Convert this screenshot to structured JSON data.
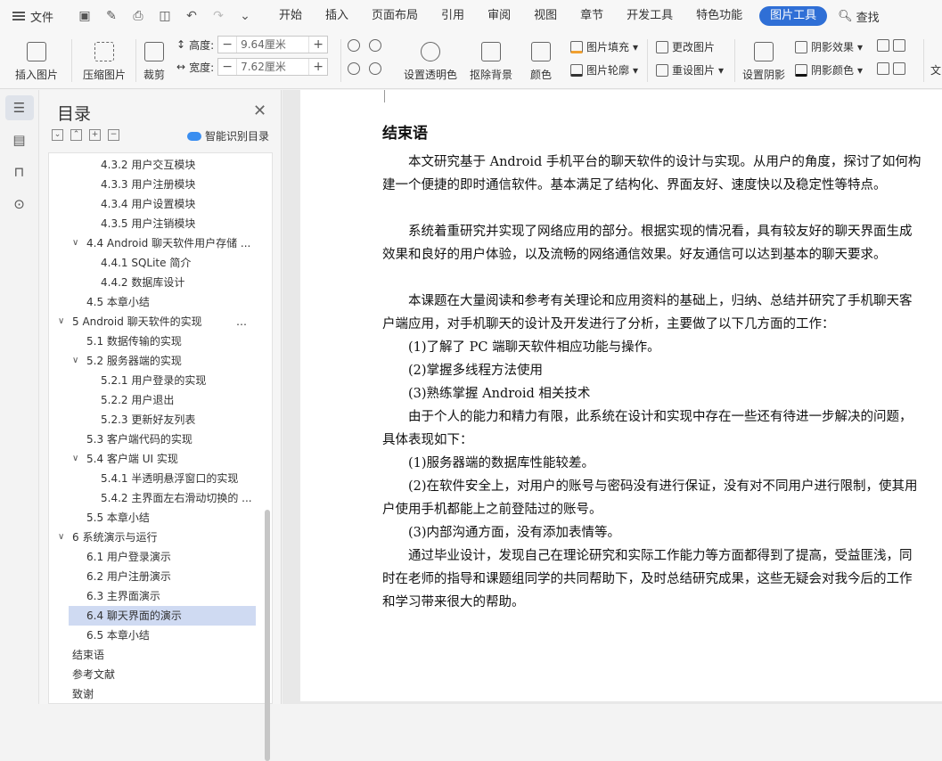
{
  "menubar": {
    "file_label": "文件",
    "tabs": [
      "开始",
      "插入",
      "页面布局",
      "引用",
      "审阅",
      "视图",
      "章节",
      "开发工具",
      "特色功能",
      "图片工具"
    ],
    "search_label": "查找"
  },
  "ribbon": {
    "insert_picture": "插入图片",
    "compress_picture": "压缩图片",
    "crop": "裁剪",
    "height_label": "高度:",
    "height_value": "9.64厘米",
    "width_label": "宽度:",
    "width_value": "7.62厘米",
    "set_transparent": "设置透明色",
    "remove_bg": "抠除背景",
    "color": "颜色",
    "picture_fill": "图片填充",
    "picture_outline": "图片轮廓",
    "change_picture": "更改图片",
    "reset_picture": "重设图片",
    "set_shadow": "设置阴影",
    "shadow_effect": "阴影效果",
    "shadow_color": "阴影颜色",
    "text_cut": "文"
  },
  "toc": {
    "title": "目录",
    "smart_label": "智能识别目录",
    "items": [
      {
        "label": "4.3.2 用户交互模块"
      },
      {
        "label": "4.3.3 用户注册模块"
      },
      {
        "label": "4.3.4 用户设置模块"
      },
      {
        "label": "4.3.5 用户注销模块"
      },
      {
        "label": "4.4 Android 聊天软件用户存储 ..."
      },
      {
        "label": "4.4.1 SQLite 简介"
      },
      {
        "label": "4.4.2 数据库设计"
      },
      {
        "label": "4.5 本章小结"
      },
      {
        "label": "5 Android 聊天软件的实现"
      },
      {
        "label": "5.1 数据传输的实现"
      },
      {
        "label": "5.2 服务器端的实现"
      },
      {
        "label": "5.2.1 用户登录的实现"
      },
      {
        "label": "5.2.2 用户退出"
      },
      {
        "label": "5.2.3 更新好友列表"
      },
      {
        "label": "5.3 客户端代码的实现"
      },
      {
        "label": "5.4 客户端 UI 实现"
      },
      {
        "label": "5.4.1 半透明悬浮窗口的实现"
      },
      {
        "label": "5.4.2 主界面左右滑动切换的 ..."
      },
      {
        "label": "5.5 本章小结"
      },
      {
        "label": "6 系统演示与运行"
      },
      {
        "label": "6.1 用户登录演示"
      },
      {
        "label": "6.2 用户注册演示"
      },
      {
        "label": "6.3 主界面演示"
      },
      {
        "label": "6.4 聊天界面的演示"
      },
      {
        "label": "6.5 本章小结"
      },
      {
        "label": "结束语"
      },
      {
        "label": "参考文献"
      },
      {
        "label": "致谢"
      }
    ]
  },
  "document": {
    "heading": "结束语",
    "paragraphs": [
      "本文研究基于 Android 手机平台的聊天软件的设计与实现。从用户的角度，探讨了如何构建一个便捷的即时通信软件。基本满足了结构化、界面友好、速度快以及稳定性等特点。",
      "系统着重研究并实现了网络应用的部分。根据实现的情况看，具有较友好的聊天界面生成效果和良好的用户体验，以及流畅的网络通信效果。好友通信可以达到基本的聊天要求。",
      "本课题在大量阅读和参考有关理论和应用资料的基础上，归纳、总结并研究了手机聊天客户端应用，对手机聊天的设计及开发进行了分析，主要做了以下几方面的工作：",
      "(1)了解了 PC 端聊天软件相应功能与操作。",
      "(2)掌握多线程方法使用",
      "(3)熟练掌握 Android 相关技术",
      "由于个人的能力和精力有限，此系统在设计和实现中存在一些还有待进一步解决的问题，具体表现如下：",
      "(1)服务器端的数据库性能较差。",
      "(2)在软件安全上，对用户的账号与密码没有进行保证，没有对不同用户进行限制，使其用户使用手机都能上之前登陆过的账号。",
      "(3)内部沟通方面，没有添加表情等。",
      "通过毕业设计，发现自己在理论研究和实际工作能力等方面都得到了提高，受益匪浅，同时在老师的指导和课题组同学的共同帮助下，及时总结研究成果，这些无疑会对我今后的工作和学习带来很大的帮助。"
    ]
  }
}
